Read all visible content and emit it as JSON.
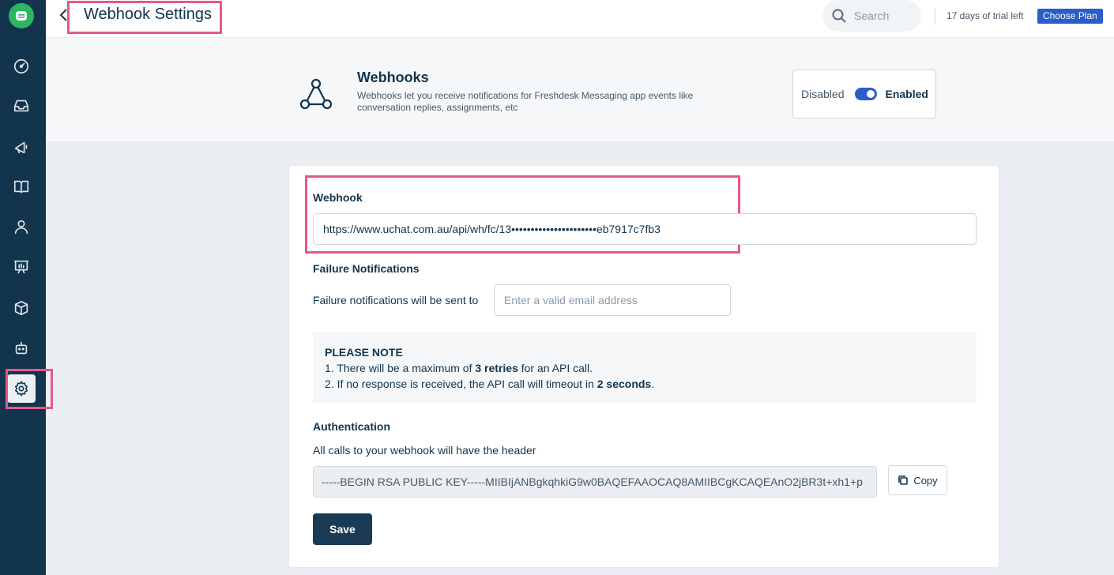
{
  "header": {
    "title": "Webhook Settings",
    "search_placeholder": "Search",
    "trial_text": "17 days of trial left",
    "choose_plan_label": "Choose Plan"
  },
  "sidebar": {
    "items": [
      {
        "icon": "dashboard-icon"
      },
      {
        "icon": "inbox-icon"
      },
      {
        "icon": "campaigns-icon"
      },
      {
        "icon": "knowledge-base-icon"
      },
      {
        "icon": "contacts-icon"
      },
      {
        "icon": "reports-icon"
      },
      {
        "icon": "integrations-icon"
      },
      {
        "icon": "bot-icon"
      },
      {
        "icon": "settings-icon",
        "active": true
      }
    ]
  },
  "banner": {
    "title": "Webhooks",
    "description": "Webhooks let you receive notifications for Freshdesk Messaging app events like conversation replies, assignments, etc",
    "toggle_off_label": "Disabled",
    "toggle_on_label": "Enabled",
    "enabled": true
  },
  "form": {
    "webhook_label": "Webhook",
    "webhook_url": "https://www.uchat.com.au/api/wh/fc/13••••••••••••••••••••••eb7917c7fb3",
    "failure_label": "Failure Notifications",
    "failure_text": "Failure notifications will be sent to",
    "email_placeholder": "Enter a valid email address",
    "note_title": "PLEASE NOTE",
    "note_line1_pre": "1. There will be a maximum of ",
    "note_line1_bold": "3 retries",
    "note_line1_post": " for an API call.",
    "note_line2_pre": "2. If no response is received, the API call will timeout in ",
    "note_line2_bold": "2 seconds",
    "note_line2_post": ".",
    "auth_label": "Authentication",
    "auth_text": "All calls to your webhook will have the header",
    "auth_key": "-----BEGIN RSA PUBLIC KEY-----MIIBIjANBgkqhkiG9w0BAQEFAAOCAQ8AMIIBCgKCAQEAnO2jBR3t+xh1+p",
    "copy_label": "Copy",
    "save_label": "Save"
  },
  "colors": {
    "sidebar_bg": "#12344d",
    "accent": "#2c5cc5",
    "highlight": "#e6578a",
    "brand_green": "#2cb660"
  }
}
